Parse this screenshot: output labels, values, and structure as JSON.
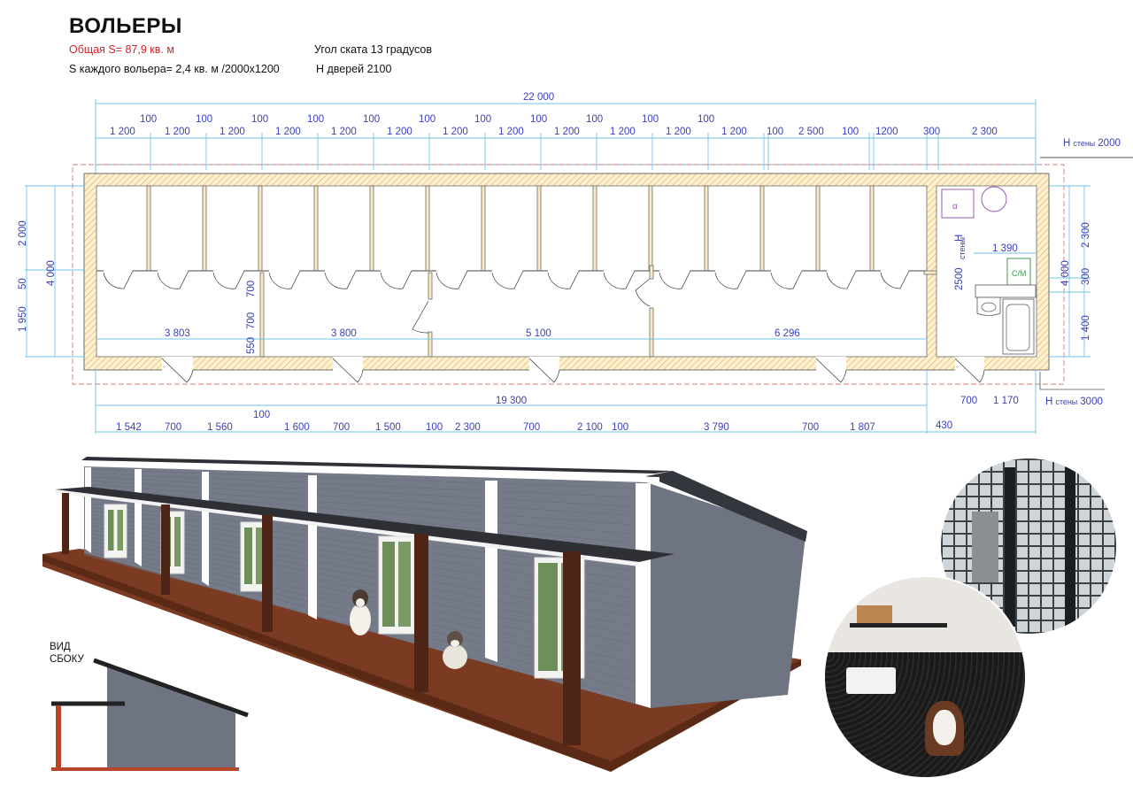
{
  "header": {
    "title": "ВОЛЬЕРЫ",
    "total_area": "Общая S= 87,9  кв. м",
    "each_area": "S каждого вольера= 2,4  кв. м  /2000х1200",
    "roof_angle": "Угол ската 13 градусов",
    "door_height": "Н дверей 2100"
  },
  "plan": {
    "overall_length": "22 000",
    "top_gaps": [
      "100",
      "100",
      "100",
      "100",
      "100",
      "100",
      "100",
      "100",
      "100",
      "100",
      "100"
    ],
    "top_modules": [
      "1 200",
      "1 200",
      "1 200",
      "1 200",
      "1 200",
      "1 200",
      "1 200",
      "1 200",
      "1 200",
      "1 200",
      "1 200",
      "1 200",
      "100",
      "2 500",
      "100",
      "1200",
      "300",
      "2 300"
    ],
    "wall_height_label": "Н",
    "wall_height_small": "стены",
    "wall_height_top_value": "2000",
    "wall_height_bottom_value": "3000",
    "left_dims": [
      "2 000",
      "50",
      "1 950",
      "4 000"
    ],
    "right_dims": [
      "2 300",
      "300",
      "1 400",
      "4 000"
    ],
    "room_dims": [
      "2500",
      "1 390",
      "С/М"
    ],
    "corridor_dims": [
      "3 803",
      "3 800",
      "5 100",
      "6 296"
    ],
    "partition_dims": [
      "700",
      "700",
      "550"
    ],
    "corridor_total": "19 300",
    "bottom_label_100": "100",
    "bottom_dims": [
      "1 542",
      "700",
      "1 560",
      "1 600",
      "700",
      "1 500",
      "100",
      "2 300",
      "700",
      "2 100",
      "100",
      "3 790",
      "700",
      "1 807"
    ],
    "bottom_right_dims": [
      "700",
      "1 170",
      "430"
    ]
  },
  "side_view": {
    "label_line1": "ВИД",
    "label_line2": "СБОКУ"
  },
  "colors": {
    "dimension_text": "#3b3fb8",
    "dimension_line": "#6fc4ea",
    "wall_fill": "#fbe9c4",
    "title_red": "#d2232a",
    "siding": "#6f7482",
    "deck": "#7a3b22",
    "roof": "#2e3035"
  }
}
